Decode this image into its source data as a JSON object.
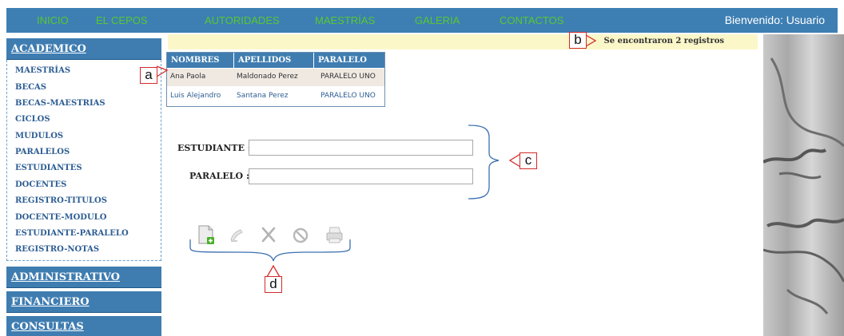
{
  "topnav": {
    "items": [
      "INICIO",
      "EL CEPOS",
      "AUTORIDADES",
      "MAESTRÍAS",
      "GALERIA",
      "CONTACTOS"
    ],
    "welcome": "Bienvenido: Usuario"
  },
  "sidebar": {
    "sections": [
      "ACADEMICO",
      "ADMINISTRATIVO",
      "FINANCIERO",
      "CONSULTAS"
    ],
    "items": [
      "MAESTRÍAS",
      "BECAS",
      "BECAS-MAESTRIAS",
      "CICLOS",
      "MUDULOS",
      "PARALELOS",
      "ESTUDIANTES",
      "DOCENTES",
      "REGISTRO-TITULOS",
      "DOCENTE-MODULO",
      "ESTUDIANTE-PARALELO",
      "REGISTRO-NOTAS"
    ]
  },
  "message": "Se encontraron 2 registros",
  "table": {
    "headers": [
      "NOMBRES",
      "APELLIDOS",
      "PARALELO"
    ],
    "rows": [
      [
        "Ana Paola",
        "Maldonado Perez",
        "PARALELO UNO"
      ],
      [
        "Luis Alejandro",
        "Santana Perez",
        "PARALELO UNO"
      ]
    ]
  },
  "form": {
    "estudiante_label": "ESTUDIANTE :",
    "estudiante_value": "",
    "paralelo_label": "PARALELO :",
    "paralelo_value": ""
  },
  "toolbar": {
    "icons": [
      "new-document-icon",
      "edit-icon",
      "delete-icon",
      "cancel-icon",
      "print-icon"
    ]
  },
  "callouts": [
    "a",
    "b",
    "c",
    "d"
  ],
  "colors": {
    "nav_bg": "#3e7fb3",
    "nav_text": "#57c82f",
    "section_bg": "#3f7db1",
    "link": "#2d5d93",
    "message_bg": "#fbf7c9",
    "callout_border": "#d42a2a",
    "bracket": "#3b6fb0"
  }
}
